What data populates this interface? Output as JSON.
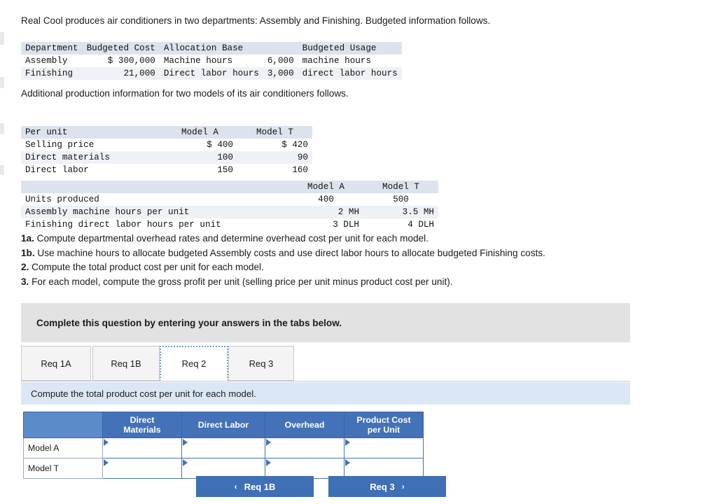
{
  "intro": {
    "line1": "Real Cool produces air conditioners in two departments: Assembly and Finishing. Budgeted information follows.",
    "line2": "Additional production information for two models of its air conditioners follows."
  },
  "dept_table": {
    "headers": [
      "Department",
      "Budgeted Cost",
      "Allocation Base",
      "",
      "Budgeted Usage"
    ],
    "rows": [
      {
        "department": "Assembly",
        "budgeted_cost": "$ 300,000",
        "allocation_base": "Machine hours",
        "usage_qty": "6,000",
        "usage_unit": "machine hours"
      },
      {
        "department": "Finishing",
        "budgeted_cost": "21,000",
        "allocation_base": "Direct labor hours",
        "usage_qty": "3,000",
        "usage_unit": "direct labor hours"
      }
    ]
  },
  "perunit_table": {
    "headers": [
      "Per unit",
      "Model A",
      "Model T"
    ],
    "rows": [
      {
        "label": "Selling price",
        "model_a": "$ 400",
        "model_t": "$ 420"
      },
      {
        "label": "Direct materials",
        "model_a": "100",
        "model_t": "90"
      },
      {
        "label": "Direct labor",
        "model_a": "150",
        "model_t": "160"
      }
    ]
  },
  "production_table": {
    "headers": [
      "",
      "Model A",
      "Model T"
    ],
    "rows": [
      {
        "label": "Units produced",
        "model_a": "400",
        "model_t": "500"
      },
      {
        "label": "Assembly machine hours per unit",
        "model_a": "2 MH",
        "model_t": "3.5 MH"
      },
      {
        "label": "Finishing direct labor hours per unit",
        "model_a": "3 DLH",
        "model_t": "4 DLH"
      }
    ]
  },
  "requirements": [
    {
      "num": "1a.",
      "text": " Compute departmental overhead rates and determine overhead cost per unit for each model."
    },
    {
      "num": "1b.",
      "text": " Use machine hours to allocate budgeted Assembly costs and use direct labor hours to allocate budgeted Finishing costs."
    },
    {
      "num": "2.",
      "text": " Compute the total product cost per unit for each model."
    },
    {
      "num": "3.",
      "text": " For each model, compute the gross profit per unit (selling price per unit minus product cost per unit)."
    }
  ],
  "banner": {
    "text": "Complete this question by entering your answers in the tabs below."
  },
  "tabs": [
    {
      "label": "Req 1A",
      "active": false
    },
    {
      "label": "Req 1B",
      "active": false
    },
    {
      "label": "Req 2",
      "active": true
    },
    {
      "label": "Req 3",
      "active": false
    }
  ],
  "question_bar": {
    "text": "Compute the total product cost per unit for each model."
  },
  "answer_table": {
    "corner_label": "",
    "columns": [
      "Direct Materials",
      "Direct Labor",
      "Overhead",
      "Product Cost per Unit"
    ],
    "column_lines": [
      [
        "Direct",
        "Materials"
      ],
      [
        "Direct Labor"
      ],
      [
        "Overhead"
      ],
      [
        "Product Cost",
        "per Unit"
      ]
    ],
    "rows": [
      {
        "label": "Model A",
        "cells": [
          "",
          "",
          "",
          ""
        ]
      },
      {
        "label": "Model T",
        "cells": [
          "",
          "",
          "",
          ""
        ]
      }
    ]
  },
  "nav": {
    "prev_label": "Req 1B",
    "next_label": "Req 3",
    "prev_chevron": "‹",
    "next_chevron": "›"
  },
  "colors": {
    "accent_blue": "#4472b8",
    "button_blue": "#3f6fb5",
    "table_header_band": "#dde3ec",
    "table_shade": "#eef1f6",
    "banner_gray": "#e2e2e2",
    "question_bar_blue": "#dbe7f4"
  }
}
